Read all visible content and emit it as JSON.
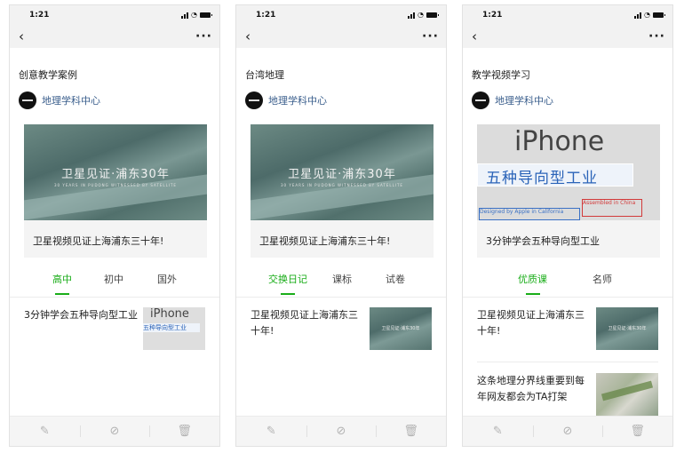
{
  "status_time": "1:21",
  "nav_more": "···",
  "nav_back": "‹",
  "icons": {
    "back": "chevron-left-icon",
    "more": "more-dots-icon",
    "edit": "pencil-icon",
    "link": "link-icon",
    "delete": "trash-icon"
  },
  "toolbar": {
    "edit": "✎",
    "link": "⊘",
    "delete": "🗑"
  },
  "colors": {
    "accent": "#1aad19",
    "link": "#3a5e8c"
  },
  "account_name": "地理学科中心",
  "covers": {
    "satellite_title": "卫星见证·浦东30年",
    "satellite_sub": "30 YEARS IN PUDONG WITNESSED BY SATELLITE",
    "iphone_big": "iPhone",
    "iphone_band": "五种导向型工业",
    "iphone_small1": "Designed by Apple in California",
    "iphone_small2": "Assembled in China"
  },
  "thumbs": {
    "satellite_text": "卫星见证·浦东30年",
    "iphone_big": "iPhone",
    "iphone_band": "五种导向型工业"
  },
  "phones": [
    {
      "title": "创意教学案例",
      "card_title": "卫星视频见证上海浦东三十年!",
      "tabs": [
        "高中",
        "初中",
        "国外"
      ],
      "items": [
        {
          "text": "3分钟学会五种导向型工业"
        }
      ]
    },
    {
      "title": "台湾地理",
      "card_title": "卫星视频见证上海浦东三十年!",
      "tabs": [
        "交换日记",
        "课标",
        "试卷"
      ],
      "items": [
        {
          "text": "卫星视频见证上海浦东三十年!"
        }
      ]
    },
    {
      "title": "教学视频学习",
      "card_title": "3分钟学会五种导向型工业",
      "tabs": [
        "优质课",
        "名师"
      ],
      "items": [
        {
          "text": "卫星视频见证上海浦东三十年!"
        },
        {
          "text": "这条地理分界线重要到每年网友都会为TA打架"
        }
      ]
    }
  ]
}
